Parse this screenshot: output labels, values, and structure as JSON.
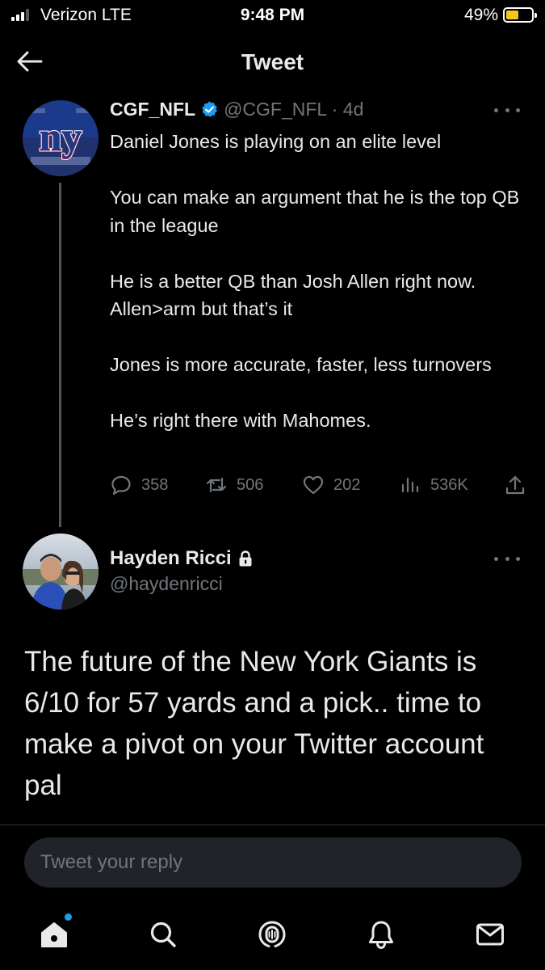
{
  "status_bar": {
    "carrier": "Verizon  LTE",
    "time": "9:48 PM",
    "battery": "49%",
    "battery_level": 0.49
  },
  "header": {
    "title": "Tweet",
    "back_icon": "arrow-left-icon"
  },
  "tweet": {
    "author_name": "CGF_NFL",
    "verified": true,
    "handle_time": "@CGF_NFL · 4d",
    "paragraphs": [
      "Daniel Jones is playing on an elite level",
      "",
      "You can make an argument that he is the top QB in the league",
      "",
      "He is a better QB than Josh Allen right now. Allen>arm but that’s it",
      "",
      "Jones is more accurate, faster, less turnovers",
      "",
      "He’s right there with Mahomes."
    ],
    "metrics": {
      "replies": "358",
      "retweets": "506",
      "likes": "202",
      "views": "536K"
    },
    "avatar_text": "ny"
  },
  "reply": {
    "author_name": "Hayden Ricci",
    "protected": true,
    "handle": "@haydenricci",
    "text": "The future of the New York Giants is 6/10 for 57 yards and a pick.. time to make a pivot on your Twitter account pal"
  },
  "reply_input": {
    "placeholder": "Tweet your reply"
  },
  "tabs": [
    {
      "name": "home",
      "icon": "home-icon",
      "has_notification_dot": true
    },
    {
      "name": "search",
      "icon": "search-icon"
    },
    {
      "name": "spaces",
      "icon": "spaces-icon"
    },
    {
      "name": "notifications",
      "icon": "bell-icon"
    },
    {
      "name": "messages",
      "icon": "mail-icon"
    }
  ],
  "colors": {
    "background": "#000000",
    "text": "#e7e9ea",
    "secondary_text": "#71767b",
    "accent": "#1d9bf0",
    "giants_blue": "#1b3a8c",
    "giants_red": "#c8102e"
  }
}
